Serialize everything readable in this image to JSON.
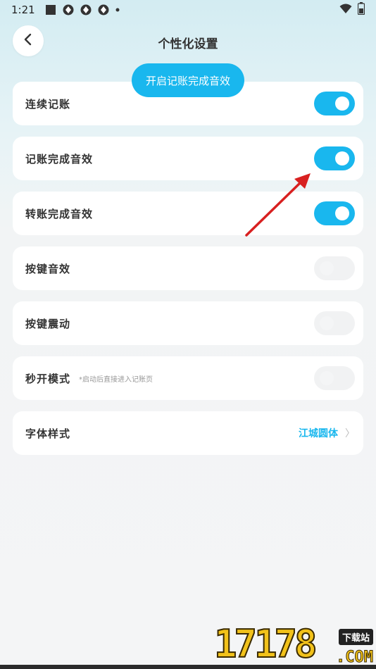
{
  "status_bar": {
    "time": "1:21"
  },
  "header": {
    "title": "个性化设置"
  },
  "toast": {
    "text": "开启记账完成音效"
  },
  "settings": [
    {
      "label": "连续记账",
      "toggle": "on"
    },
    {
      "label": "记账完成音效",
      "toggle": "on"
    },
    {
      "label": "转账完成音效",
      "toggle": "on"
    },
    {
      "label": "按键音效",
      "toggle": "off"
    },
    {
      "label": "按键震动",
      "toggle": "off"
    },
    {
      "label": "秒开模式",
      "hint": "*启动后直接进入记账页",
      "toggle": "off"
    }
  ],
  "font_style": {
    "label": "字体样式",
    "value": "江城圆体",
    "chevron": "〉"
  },
  "watermark": {
    "digits": "17178",
    "tag": "下载站",
    "com": ".COM"
  },
  "colors": {
    "accent": "#19b7ee",
    "annotation_arrow": "#e02020"
  }
}
